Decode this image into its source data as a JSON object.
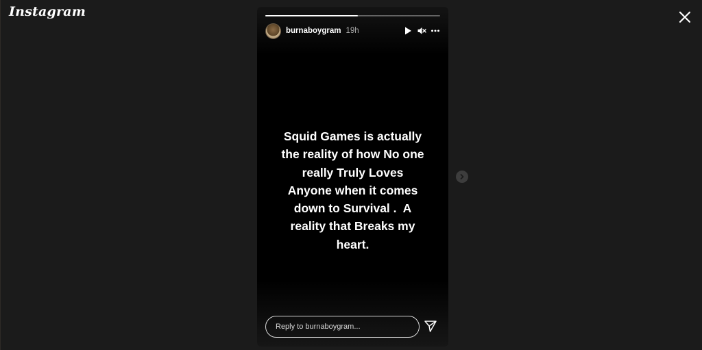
{
  "app": {
    "logo_text": "Instagram"
  },
  "story": {
    "username": "burnaboygram",
    "time_ago": "19h",
    "progress": 0.53,
    "text_lines": [
      "Squid Games is actually",
      "the reality of how No one",
      "really Truly Loves",
      "Anyone when it comes",
      "down to Survival .  A",
      "reality that Breaks my",
      "heart."
    ],
    "reply_placeholder": "Reply to burnaboygram..."
  },
  "icons": {
    "close": "close-icon",
    "play": "play-icon",
    "mute": "speaker-muted-icon",
    "more": "more-options-icon",
    "send": "send-icon",
    "next": "chevron-right-icon"
  },
  "colors": {
    "background": "#1b1b1b",
    "story_background": "#000000",
    "text": "#ffffff",
    "secondary_text": "#a8a8a8"
  }
}
